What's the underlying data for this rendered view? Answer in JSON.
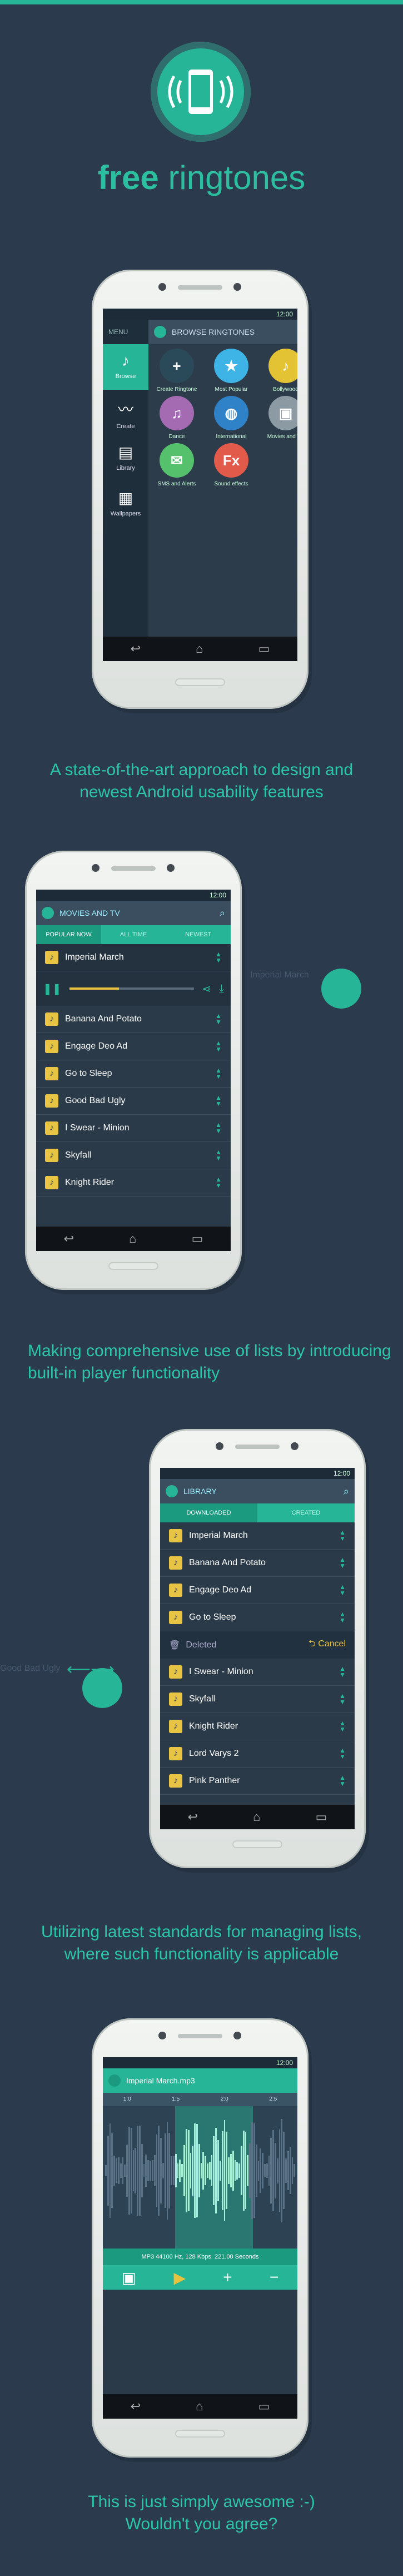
{
  "header": {
    "brand_bold": "free",
    "brand_rest": "ringtones"
  },
  "taglines": [
    "A state-of-the-art approach to design and newest Android usability features",
    "Making comprehensive use of lists by introducing built-in player functionality",
    "Utilizing latest standards for managing lists, where such functionality is applicable",
    "This is just simply awesome :-) Wouldn't you agree?"
  ],
  "status_time": "12:00",
  "phone1": {
    "menu_label": "MENU",
    "title": "BROWSE RINGTONES",
    "side": [
      {
        "label": "Browse"
      },
      {
        "label": "Create"
      },
      {
        "label": "Library"
      },
      {
        "label": "Wallpapers"
      }
    ],
    "tiles": [
      {
        "label": "Create Ringtone",
        "color": "#2a4a5a",
        "glyph": "+"
      },
      {
        "label": "Most Popular",
        "color": "#3db3e6",
        "glyph": "★"
      },
      {
        "label": "Bollywood",
        "color": "#e3c234",
        "glyph": "♪"
      },
      {
        "label": "Dance",
        "color": "#a46bb3",
        "glyph": "♫"
      },
      {
        "label": "International",
        "color": "#2f82c8",
        "glyph": "◍"
      },
      {
        "label": "Movies and TV",
        "color": "#8b9aa3",
        "glyph": "▣"
      },
      {
        "label": "SMS and Alerts",
        "color": "#56c16d",
        "glyph": "✉"
      },
      {
        "label": "Sound effects",
        "color": "#e25a4a",
        "glyph": "Fx"
      }
    ]
  },
  "phone2": {
    "title": "MOVIES AND TV",
    "tabs": [
      "POPULAR NOW",
      "ALL TIME",
      "NEWEST"
    ],
    "playing": "Imperial March",
    "rows": [
      "Banana And Potato",
      "Engage Deo Ad",
      "Go to Sleep",
      "Good Bad Ugly",
      "I Swear - Minion",
      "Skyfall",
      "Knight Rider"
    ],
    "side_hint": "Imperial March"
  },
  "phone3": {
    "title": "LIBRARY",
    "tabs": [
      "DOWNLOADED",
      "CREATED"
    ],
    "rows_top": [
      "Imperial March",
      "Banana And Potato",
      "Engage Deo Ad",
      "Go to Sleep"
    ],
    "deleted_label": "Deleted",
    "cancel_label": "Cancel",
    "rows_bottom": [
      "I Swear - Minion",
      "Skyfall",
      "Knight Rider",
      "Lord Varys 2",
      "Pink Panther"
    ],
    "side_hint": "Good Bad Ugly"
  },
  "phone4": {
    "title": "Imperial March.mp3",
    "marks": [
      "1:0",
      "1:5",
      "2:0",
      "2:5"
    ],
    "info": "MP3 44100 Hz, 128 Kbps, 221.00 Seconds"
  }
}
